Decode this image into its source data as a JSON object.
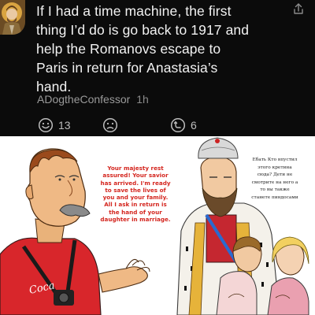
{
  "post": {
    "lines": [
      "If I had a time machine, the first",
      "thing I’d do is go back to 1917 and",
      "help the Romanovs escape to",
      "Paris in return for Anastasia’s",
      "hand."
    ],
    "author": "ADogtheConfessor",
    "time": "1h",
    "upvotes": "13",
    "reshares": "6",
    "icons": {
      "avatar": "saint-icon-avatar",
      "share": "share-icon",
      "upvote": "smiley-upvote-icon",
      "downvote": "frown-downvote-icon",
      "reshare": "reshare-icon"
    }
  },
  "comic": {
    "left_bubble": [
      "Your majesty rest",
      "assured! Your savior",
      "has arrived. I'm ready",
      "to save the lives of",
      "you and your family.",
      "All I ask in return is",
      "the hand of your",
      "daughter in marriage."
    ],
    "right_bubble": [
      "Ебать Кто впустил",
      "этого кретина",
      "сюда? Дети не",
      "смотрите на него а",
      "то вы также",
      "станете пиндосами"
    ],
    "shirt_text": "Coca"
  }
}
